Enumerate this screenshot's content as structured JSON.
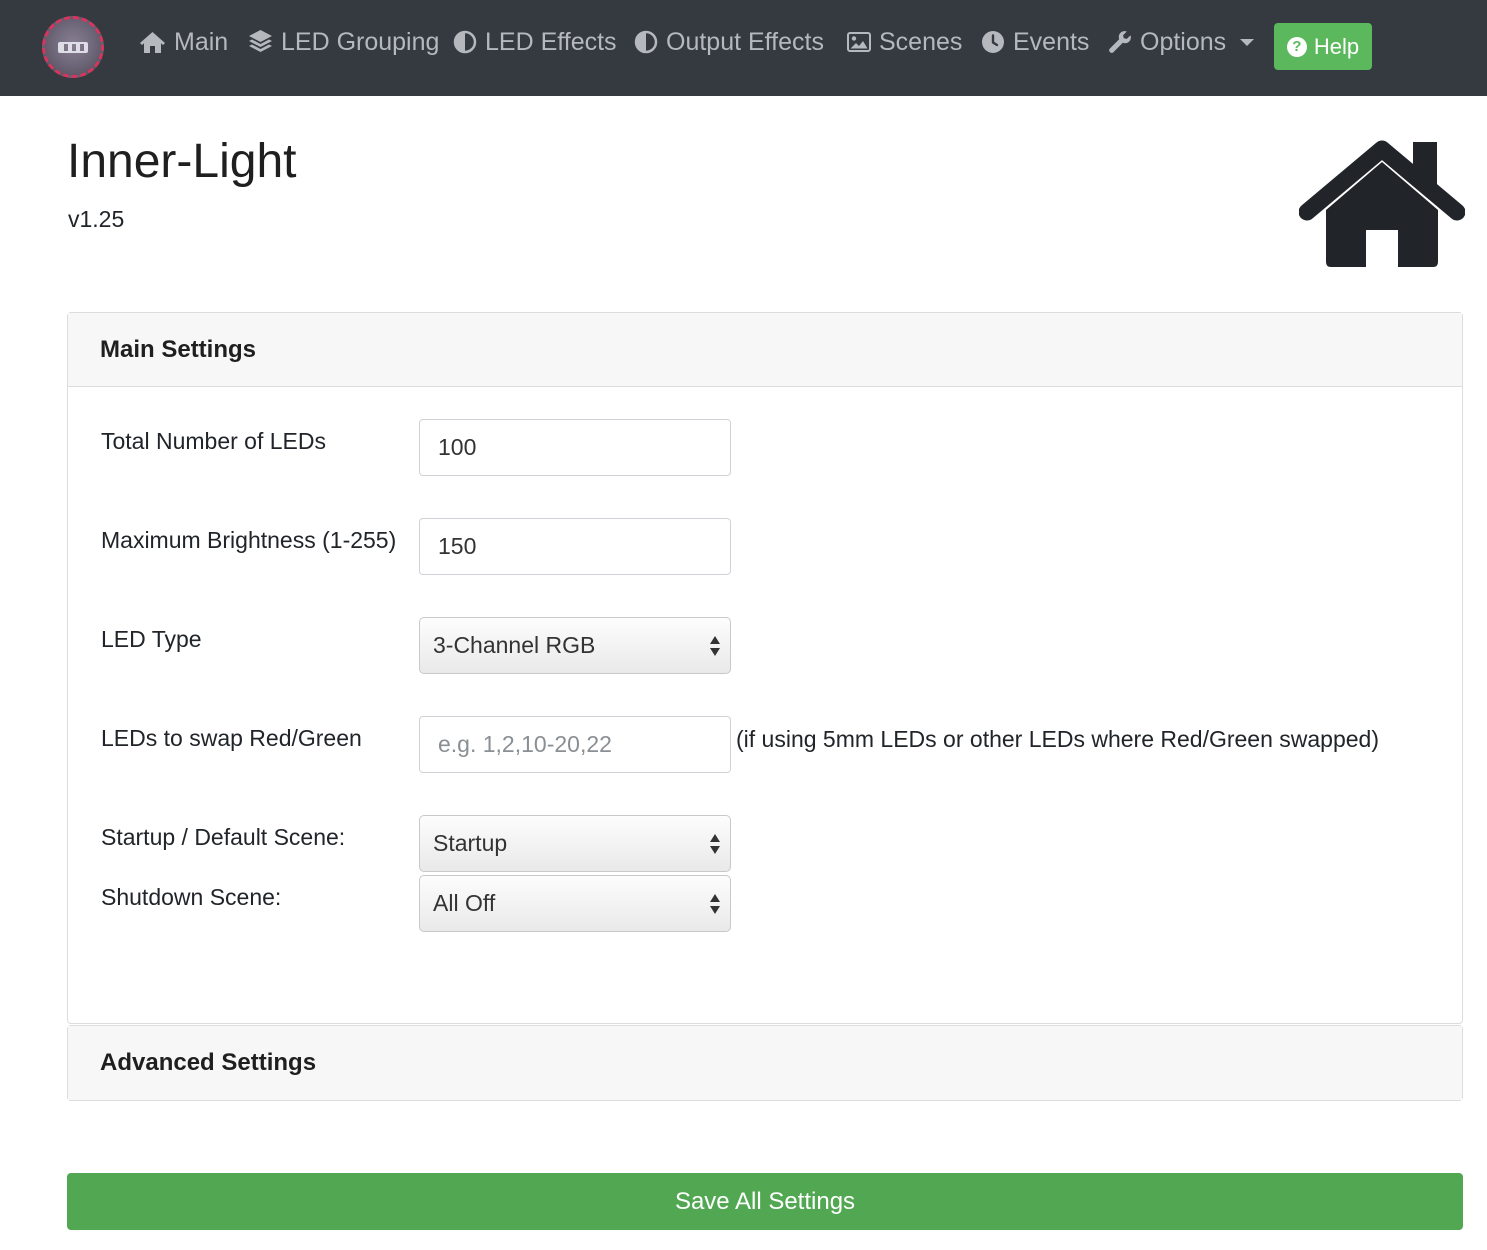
{
  "nav": {
    "items": [
      {
        "label": "Main",
        "icon": "home-icon"
      },
      {
        "label": "LED Grouping",
        "icon": "layers-icon"
      },
      {
        "label": "LED Effects",
        "icon": "adjust-icon"
      },
      {
        "label": "Output Effects",
        "icon": "adjust-icon"
      },
      {
        "label": "Scenes",
        "icon": "image-icon"
      },
      {
        "label": "Events",
        "icon": "clock-icon"
      },
      {
        "label": "Options",
        "icon": "wrench-icon"
      }
    ],
    "help_label": "Help"
  },
  "header": {
    "title": "Inner-Light",
    "version": "v1.25"
  },
  "main_settings": {
    "title": "Main Settings",
    "total_leds": {
      "label": "Total Number of LEDs",
      "value": "100"
    },
    "max_brightness": {
      "label": "Maximum Brightness (1-255)",
      "value": "150"
    },
    "led_type": {
      "label": "LED Type",
      "selected": "3-Channel RGB"
    },
    "swap_rg": {
      "label": "LEDs to swap Red/Green",
      "value": "",
      "placeholder": "e.g. 1,2,10-20,22",
      "hint": "(if using 5mm LEDs or other LEDs where Red/Green swapped)"
    },
    "startup_scene": {
      "label": "Startup / Default Scene:",
      "selected": "Startup"
    },
    "shutdown_scene": {
      "label": "Shutdown Scene:",
      "selected": "All Off"
    }
  },
  "advanced_settings": {
    "title": "Advanced Settings"
  },
  "save_label": "Save All Settings",
  "colors": {
    "navbar": "#343a40",
    "help": "#5cb85c",
    "save": "#52a752"
  }
}
